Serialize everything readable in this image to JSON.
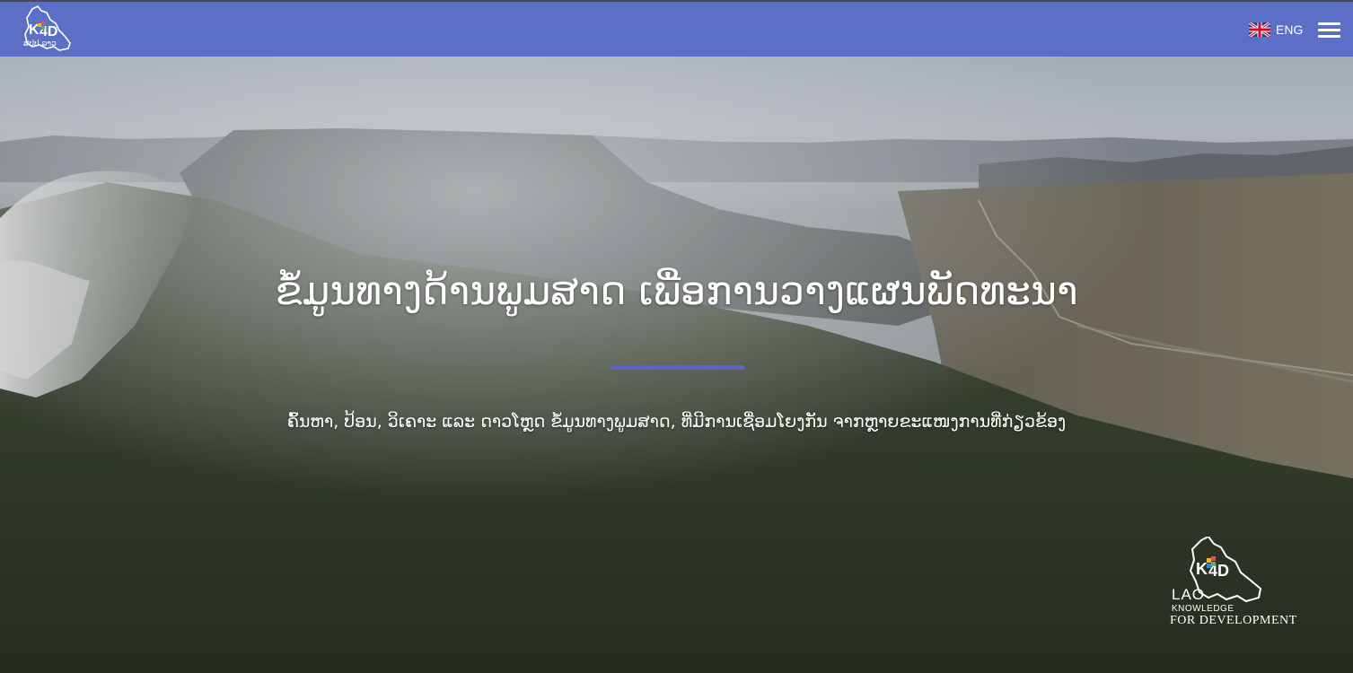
{
  "header": {
    "logo_text": "ສປປ ລາວ",
    "language_label": "ENG",
    "menu_icon": "hamburger-menu-icon",
    "colors": {
      "bar": "#5a6fc5"
    }
  },
  "hero": {
    "title": "ຂໍ້ມູນທາງດ້ານພູມສາດ ເພື່ອການວາງແຜນພັດທະນາ",
    "subtitle": "ຄົ້ນຫາ, ປ້ອນ, ວິເຄາະ ແລະ ດາວໂຫຼດ ຂໍ້ມູນທາງພູມສາດ, ທີ່ມີການເຊື່ອມໂຍງກັນ ຈາກຫຼາຍຂະແໜງການທີ່ກ່ຽວຂ້ອງ",
    "accent_color": "#5a63c8"
  },
  "wordmark": {
    "line1": "LAO",
    "line2": "KNOWLEDGE",
    "line3": "FOR DEVELOPMENT"
  }
}
